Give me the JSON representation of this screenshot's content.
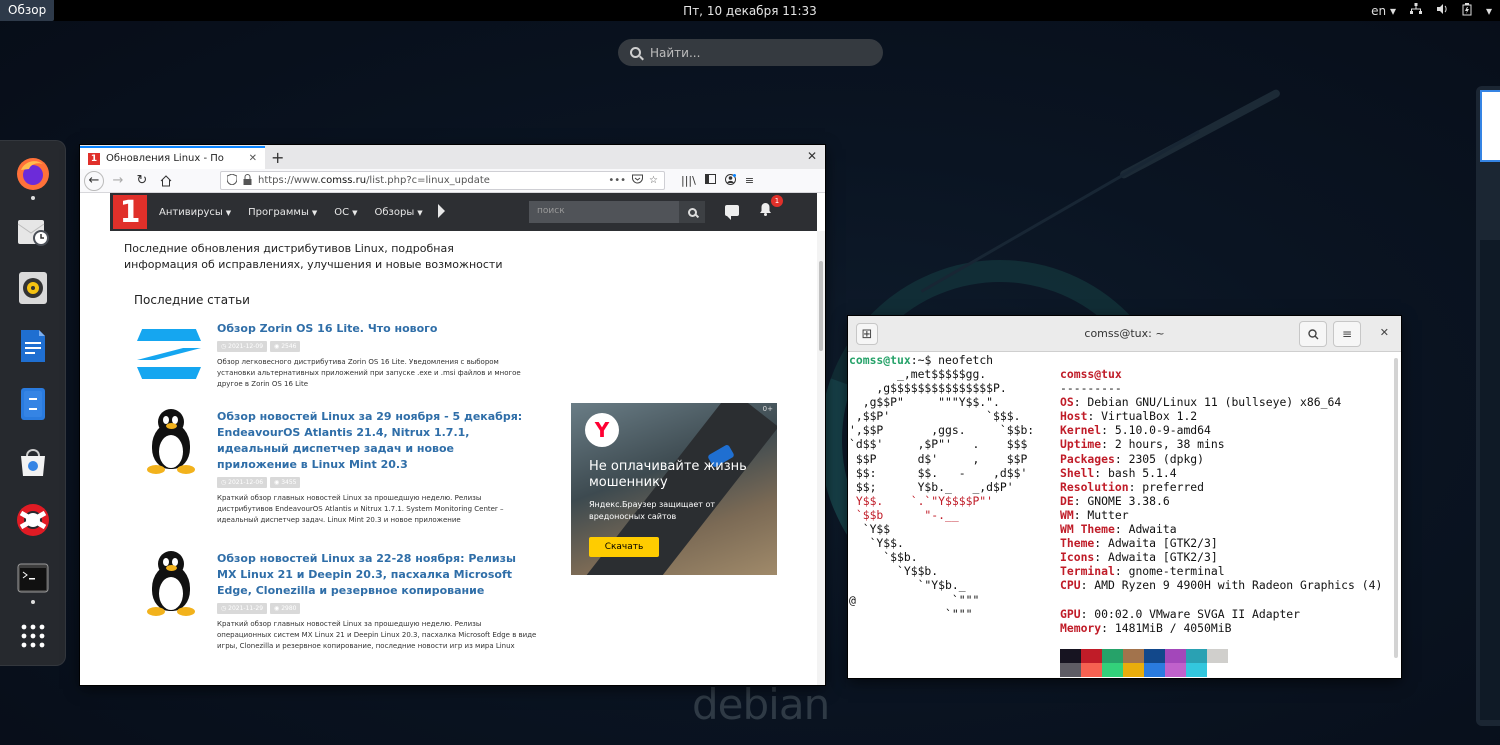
{
  "topbar": {
    "activities": "Обзор",
    "clock": "Пт, 10 декабря  11:33",
    "lang": "en"
  },
  "search": {
    "placeholder": "Найти..."
  },
  "dash": {
    "apps": [
      "firefox",
      "evolution-mail",
      "rhythmbox",
      "libreoffice-writer",
      "files",
      "software",
      "help",
      "terminal",
      "show-apps"
    ]
  },
  "firefox": {
    "tab_title": "Обновления Linux - По",
    "url_prefix": "https://www.",
    "url_domain": "comss.ru",
    "url_path": "/list.php?c=linux_update",
    "site": {
      "logo_text": "1",
      "menu": [
        "Антивирусы",
        "Программы",
        "ОС",
        "Обзоры"
      ],
      "search_placeholder": "поиск",
      "notif_count": "1",
      "intro": "Последние обновления дистрибутивов Linux, подробная информация об исправлениях, улучшения и новые возможности",
      "section_title": "Последние статьи",
      "articles": [
        {
          "title": "Обзор Zorin OS 16 Lite. Что нового",
          "date": "2021-12-09",
          "views": "2546",
          "desc": "Обзор легковесного дистрибутива Zorin OS 16 Lite. Уведомления с выбором установки альтернативных приложений при запуске .exe и .msi файлов и многое другое в Zorin OS 16 Lite"
        },
        {
          "title": "Обзор новостей Linux за 29 ноября - 5 декабря: EndeavourOS Atlantis 21.4, Nitrux 1.7.1, идеальный диспетчер задач и новое приложение в Linux Mint 20.3",
          "date": "2021-12-06",
          "views": "3455",
          "desc": "Краткий обзор главных новостей Linux за прошедшую неделю. Релизы дистрибутивов EndeavourOS Atlantis и Nitrux 1.7.1. System Monitoring Center – идеальный диспетчер задач. Linux Mint 20.3 и новое приложение"
        },
        {
          "title": "Обзор новостей Linux за 22-28 ноября: Релизы MX Linux 21 и Deepin 20.3, пасхалка Microsoft Edge, Clonezilla и резервное копирование",
          "date": "2021-11-29",
          "views": "2980",
          "desc": "Краткий обзор главных новостей Linux за прошедшую неделю. Релизы операционных систем MX Linux 21 и Deepin Linux 20.3, пасхалка Microsoft Edge в виде игры, Clonezilla и резервное копирование, последние новости игр из мира Linux"
        }
      ],
      "ad": {
        "headline": "Не оплачивайте жизнь мошеннику",
        "sub": "Яндекс.Браузер защищает от вредоносных сайтов",
        "button": "Скачать",
        "close": "0+"
      }
    }
  },
  "terminal": {
    "title": "comss@tux: ~",
    "prompt_user": "comss@tux",
    "prompt_path": ":~$ ",
    "command": "neofetch",
    "ascii": [
      "       _,met$$$$$gg.",
      "    ,g$$$$$$$$$$$$$$$P.",
      "  ,g$$P\"     \"\"\"Y$$.\".",
      " ,$$P'              `$$$.",
      "',$$P       ,ggs.     `$$b:",
      "`d$$'     ,$P\"'   .    $$$",
      " $$P      d$'     ,    $$P",
      " $$:      $$.   -    ,d$$'",
      " $$;      Y$b._   _,d$P'",
      " Y$$.    `.`\"Y$$$$P\"'",
      " `$$b      \"-.__",
      "  `Y$$",
      "   `Y$$.",
      "     `$$b.",
      "       `Y$$b.",
      "          `\"Y$b._",
      "@              `\"\"\"",
      "              `\"\"\""
    ],
    "host_header": "comss@tux",
    "separator": "---------",
    "info": [
      {
        "key": "OS",
        "value": "Debian GNU/Linux 11 (bullseye) x86_64"
      },
      {
        "key": "Host",
        "value": "VirtualBox 1.2"
      },
      {
        "key": "Kernel",
        "value": "5.10.0-9-amd64"
      },
      {
        "key": "Uptime",
        "value": "2 hours, 38 mins"
      },
      {
        "key": "Packages",
        "value": "2305 (dpkg)"
      },
      {
        "key": "Shell",
        "value": "bash 5.1.4"
      },
      {
        "key": "Resolution",
        "value": "preferred"
      },
      {
        "key": "DE",
        "value": "GNOME 3.38.6"
      },
      {
        "key": "WM",
        "value": "Mutter"
      },
      {
        "key": "WM Theme",
        "value": "Adwaita"
      },
      {
        "key": "Theme",
        "value": "Adwaita [GTK2/3]"
      },
      {
        "key": "Icons",
        "value": "Adwaita [GTK2/3]"
      },
      {
        "key": "Terminal",
        "value": "gnome-terminal"
      },
      {
        "key": "CPU",
        "value": "AMD Ryzen 9 4900H with Radeon Graphics (4)"
      },
      {
        "key": "GPU",
        "value": "00:02.0 VMware SVGA II Adapter"
      },
      {
        "key": "Memory",
        "value": "1481MiB / 4050MiB"
      }
    ],
    "palette": [
      "#171421",
      "#c01c28",
      "#26a269",
      "#a2734c",
      "#12488b",
      "#a347ba",
      "#2aa1b3",
      "#d0cfcc",
      "#5e5c64",
      "#f66151",
      "#33d17a",
      "#e9ad0c",
      "#2a7bde",
      "#c061cb",
      "#33c7de",
      "#ffffff"
    ]
  },
  "background": {
    "wordmark": "debian"
  }
}
